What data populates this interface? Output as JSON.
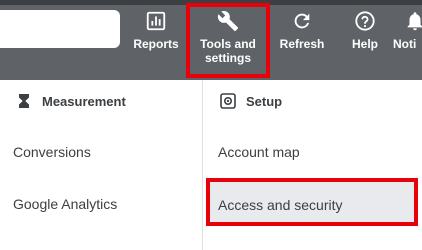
{
  "toolbar": {
    "reports_label": "Reports",
    "tools_label": "Tools and\nsettings",
    "refresh_label": "Refresh",
    "help_label": "Help",
    "notifications_label": "Noti"
  },
  "menu": {
    "measurement": {
      "heading": "Measurement",
      "items": [
        "Conversions",
        "Google Analytics"
      ]
    },
    "setup": {
      "heading": "Setup",
      "items": [
        "Account map",
        "Access and security"
      ]
    }
  },
  "colors": {
    "header_bg": "#5f6368",
    "highlight": "#e8000b",
    "selected_bg": "#e8eaed"
  }
}
